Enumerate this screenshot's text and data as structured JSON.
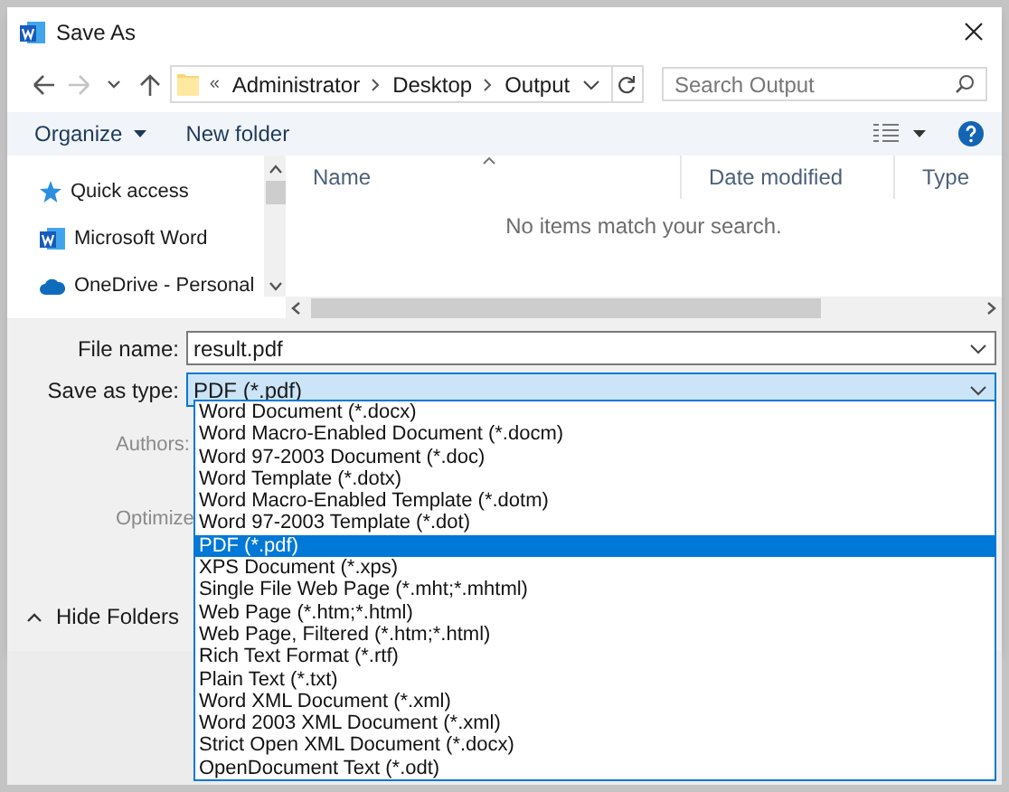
{
  "window": {
    "title": "Save As"
  },
  "nav": [
    {
      "kind": "back",
      "disabled": false
    },
    {
      "kind": "forward",
      "disabled": true
    },
    {
      "kind": "recent",
      "disabled": false
    },
    {
      "kind": "up",
      "disabled": false
    }
  ],
  "address": {
    "prefix": "«",
    "crumbs": [
      "Administrator",
      "Desktop",
      "Output"
    ]
  },
  "search": {
    "placeholder": "Search Output"
  },
  "toolbar": [
    {
      "label": "Organize",
      "menu": true
    },
    {
      "label": "New folder",
      "menu": false
    }
  ],
  "sidebar": {
    "items": [
      {
        "label": "Quick access",
        "kind": "star"
      },
      {
        "label": "Microsoft Word",
        "kind": "word"
      },
      {
        "label": "OneDrive - Personal",
        "kind": "cloud"
      }
    ]
  },
  "columns": [
    {
      "label": "Name",
      "sorted": true
    },
    {
      "label": "Date modified",
      "sorted": false
    },
    {
      "label": "Type",
      "sorted": false
    }
  ],
  "empty_message": "No items match your search.",
  "file_name": {
    "label": "File name:",
    "value": "result.pdf"
  },
  "save_type": {
    "label": "Save as type:",
    "value": "PDF (*.pdf)",
    "expanded": true
  },
  "authors_label": "Authors:",
  "optimize_label": "Optimize",
  "hide_folders": "Hide Folders",
  "options": [
    {
      "label": "Word Document (*.docx)",
      "selected": false
    },
    {
      "label": "Word Macro-Enabled Document (*.docm)",
      "selected": false
    },
    {
      "label": "Word 97-2003 Document (*.doc)",
      "selected": false
    },
    {
      "label": "Word Template (*.dotx)",
      "selected": false
    },
    {
      "label": "Word Macro-Enabled Template (*.dotm)",
      "selected": false
    },
    {
      "label": "Word 97-2003 Template (*.dot)",
      "selected": false
    },
    {
      "label": "PDF (*.pdf)",
      "selected": true
    },
    {
      "label": "XPS Document (*.xps)",
      "selected": false
    },
    {
      "label": "Single File Web Page (*.mht;*.mhtml)",
      "selected": false
    },
    {
      "label": "Web Page (*.htm;*.html)",
      "selected": false
    },
    {
      "label": "Web Page, Filtered (*.htm;*.html)",
      "selected": false
    },
    {
      "label": "Rich Text Format (*.rtf)",
      "selected": false
    },
    {
      "label": "Plain Text (*.txt)",
      "selected": false
    },
    {
      "label": "Word XML Document (*.xml)",
      "selected": false
    },
    {
      "label": "Word 2003 XML Document (*.xml)",
      "selected": false
    },
    {
      "label": "Strict Open XML Document (*.docx)",
      "selected": false
    },
    {
      "label": "OpenDocument Text (*.odt)",
      "selected": false
    }
  ]
}
